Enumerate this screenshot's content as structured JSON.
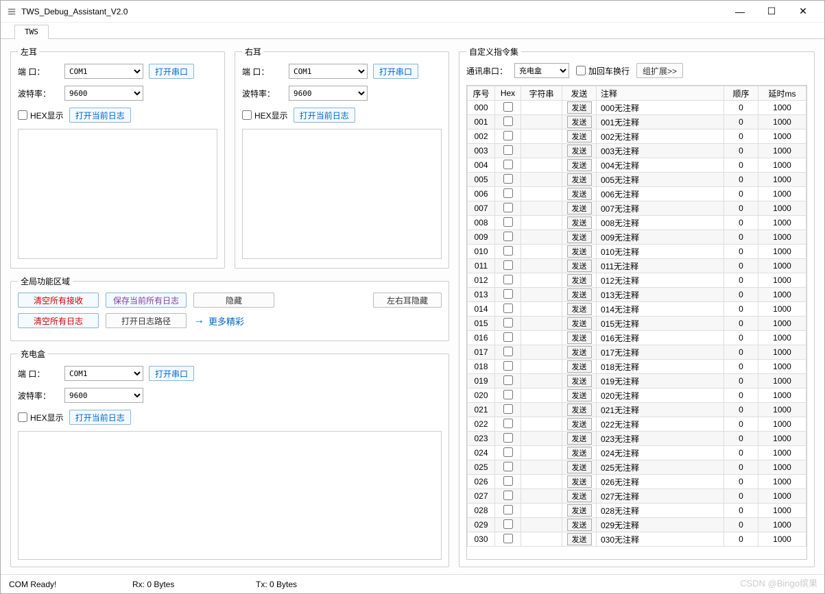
{
  "window": {
    "title": "TWS_Debug_Assistant_V2.0"
  },
  "tab": "TWS",
  "labels": {
    "port": "端  口：",
    "baud": "波特率：",
    "hex_display": "HEX显示",
    "open_port": "打开串口",
    "open_log": "打开当前日志"
  },
  "left_ear": {
    "legend": "左耳",
    "port": "COM1",
    "baud": "9600"
  },
  "right_ear": {
    "legend": "右耳",
    "port": "COM1",
    "baud": "9600"
  },
  "global": {
    "legend": "全局功能区域",
    "clear_recv": "清空所有接收",
    "save_logs": "保存当前所有日志",
    "hide": "隐藏",
    "hide_ears": "左右耳隐藏",
    "clear_logs": "清空所有日志",
    "open_log_path": "打开日志路径",
    "more": "更多精彩"
  },
  "charger": {
    "legend": "充电盒",
    "port": "COM1",
    "baud": "9600"
  },
  "cmdset": {
    "legend": "自定义指令集",
    "comm_port_label": "通讯串口：",
    "comm_port": "充电盒",
    "add_crlf": "加回车换行",
    "group_expand": "组扩展>>",
    "headers": {
      "seq": "序号",
      "hex": "Hex",
      "str": "字符串",
      "send": "发送",
      "note": "注释",
      "order": "顺序",
      "delay": "延时ms"
    },
    "send_label": "发送",
    "rows": [
      {
        "seq": "000",
        "note": "000无注释",
        "order": 0,
        "delay": 1000
      },
      {
        "seq": "001",
        "note": "001无注释",
        "order": 0,
        "delay": 1000
      },
      {
        "seq": "002",
        "note": "002无注释",
        "order": 0,
        "delay": 1000
      },
      {
        "seq": "003",
        "note": "003无注释",
        "order": 0,
        "delay": 1000
      },
      {
        "seq": "004",
        "note": "004无注释",
        "order": 0,
        "delay": 1000
      },
      {
        "seq": "005",
        "note": "005无注释",
        "order": 0,
        "delay": 1000
      },
      {
        "seq": "006",
        "note": "006无注释",
        "order": 0,
        "delay": 1000
      },
      {
        "seq": "007",
        "note": "007无注释",
        "order": 0,
        "delay": 1000
      },
      {
        "seq": "008",
        "note": "008无注释",
        "order": 0,
        "delay": 1000
      },
      {
        "seq": "009",
        "note": "009无注释",
        "order": 0,
        "delay": 1000
      },
      {
        "seq": "010",
        "note": "010无注释",
        "order": 0,
        "delay": 1000
      },
      {
        "seq": "011",
        "note": "011无注释",
        "order": 0,
        "delay": 1000
      },
      {
        "seq": "012",
        "note": "012无注释",
        "order": 0,
        "delay": 1000
      },
      {
        "seq": "013",
        "note": "013无注释",
        "order": 0,
        "delay": 1000
      },
      {
        "seq": "014",
        "note": "014无注释",
        "order": 0,
        "delay": 1000
      },
      {
        "seq": "015",
        "note": "015无注释",
        "order": 0,
        "delay": 1000
      },
      {
        "seq": "016",
        "note": "016无注释",
        "order": 0,
        "delay": 1000
      },
      {
        "seq": "017",
        "note": "017无注释",
        "order": 0,
        "delay": 1000
      },
      {
        "seq": "018",
        "note": "018无注释",
        "order": 0,
        "delay": 1000
      },
      {
        "seq": "019",
        "note": "019无注释",
        "order": 0,
        "delay": 1000
      },
      {
        "seq": "020",
        "note": "020无注释",
        "order": 0,
        "delay": 1000
      },
      {
        "seq": "021",
        "note": "021无注释",
        "order": 0,
        "delay": 1000
      },
      {
        "seq": "022",
        "note": "022无注释",
        "order": 0,
        "delay": 1000
      },
      {
        "seq": "023",
        "note": "023无注释",
        "order": 0,
        "delay": 1000
      },
      {
        "seq": "024",
        "note": "024无注释",
        "order": 0,
        "delay": 1000
      },
      {
        "seq": "025",
        "note": "025无注释",
        "order": 0,
        "delay": 1000
      },
      {
        "seq": "026",
        "note": "026无注释",
        "order": 0,
        "delay": 1000
      },
      {
        "seq": "027",
        "note": "027无注释",
        "order": 0,
        "delay": 1000
      },
      {
        "seq": "028",
        "note": "028无注释",
        "order": 0,
        "delay": 1000
      },
      {
        "seq": "029",
        "note": "029无注释",
        "order": 0,
        "delay": 1000
      },
      {
        "seq": "030",
        "note": "030无注释",
        "order": 0,
        "delay": 1000
      }
    ]
  },
  "status": {
    "com": "COM Ready!",
    "rx": "Rx: 0 Bytes",
    "tx": "Tx: 0 Bytes"
  },
  "watermark": "CSDN @Bingo缤果"
}
